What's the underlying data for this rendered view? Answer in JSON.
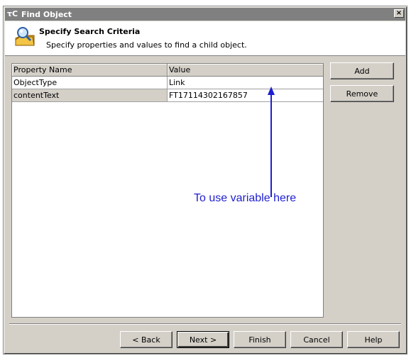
{
  "window": {
    "title": "Find Object",
    "icon": "tc-app-icon",
    "close_glyph": "×"
  },
  "header": {
    "title": "Specify Search Criteria",
    "subtitle": "Specify properties and values to find a child object.",
    "icon": "search-folder-icon"
  },
  "grid": {
    "columns": [
      "Property Name",
      "Value"
    ],
    "rows": [
      {
        "property": "ObjectType",
        "value": "Link"
      },
      {
        "property": "contentText",
        "value": "FT17114302167857"
      }
    ]
  },
  "side_buttons": {
    "add": "Add",
    "remove": "Remove"
  },
  "footer_buttons": {
    "back": "< Back",
    "next": "Next >",
    "finish": "Finish",
    "cancel": "Cancel",
    "help": "Help"
  },
  "annotation": {
    "text": "To use variable here",
    "color": "#1f1fd0"
  }
}
